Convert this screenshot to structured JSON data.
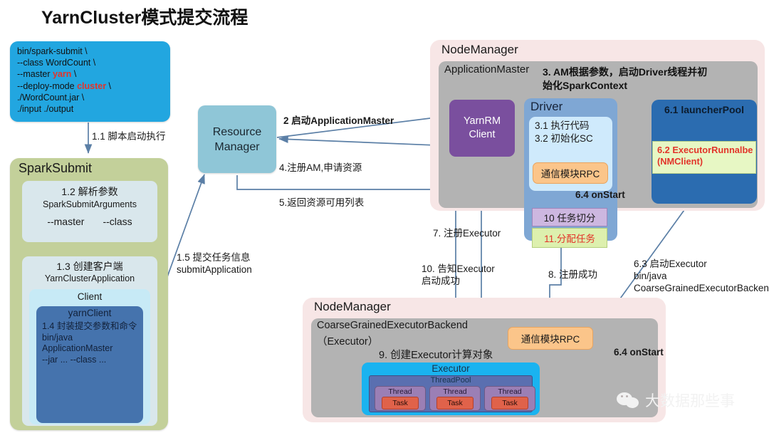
{
  "title": "YarnCluster模式提交流程",
  "command_box": {
    "lines": [
      {
        "text": "bin/spark-submit \\",
        "highlight": ""
      },
      {
        "text": "--class WordCount \\",
        "highlight": ""
      },
      {
        "pre": "--master ",
        "highlight": "yarn",
        "post": " \\"
      },
      {
        "pre": "--deploy-mode ",
        "highlight": "cluster",
        "post": " \\"
      },
      {
        "text": "./WordCount.jar \\",
        "highlight": ""
      },
      {
        "text": "./input ./output",
        "highlight": ""
      }
    ],
    "color": "#22a6e0",
    "highlight_color": "#e2342a"
  },
  "spark_submit": {
    "title": "SparkSubmit",
    "color": "#c3d09a",
    "args_box": {
      "heading": "1.2 解析参数",
      "class_name": "SparkSubmitArguments",
      "opt_master": "--master",
      "opt_class": "--class"
    },
    "client_box": {
      "heading": "1.3 创建客户端",
      "class_name": "YarnClusterApplication",
      "client_label": "Client",
      "yarn_client_label": "yarnClient",
      "detail_lines": [
        "1.4 封装提交参数和命令",
        "bin/java",
        "ApplicationMaster",
        "--jar ... --class ..."
      ]
    }
  },
  "resource_manager": {
    "line1": "Resource",
    "line2": "Manager",
    "color": "#8fc6d7"
  },
  "node_manager_top": {
    "title": "NodeManager",
    "application_master": {
      "title": "ApplicationMaster",
      "note_line1": "3. AM根据参数，启动Driver线程并初",
      "note_line2": "始化SparkContext"
    },
    "yarn_rm_client": {
      "line1": "YarnRM",
      "line2": "Client",
      "color": "#7a4f9e"
    },
    "driver": {
      "title": "Driver",
      "color": "#7fa7d4",
      "step_3_1": "3.1 执行代码",
      "step_3_2": "3.2 初始化SC",
      "rpc_label": "通信模块RPC",
      "split_task": "10 任务切分",
      "assign_task": "11.分配任务"
    },
    "launcher_pool": {
      "title": "6.1 launcherPool",
      "color": "#2b6cb0",
      "executor_runnable_line1": "6.2 ExecutorRunnalbe",
      "executor_runnable_line2": "(NMClient)"
    }
  },
  "node_manager_bottom": {
    "title": "NodeManager",
    "backend_line1": "CoarseGrainedExecutorBackend",
    "backend_line2": "（Executor）",
    "backend_line3": "9. 创建Executor计算对象",
    "rpc_label": "通信模块RPC",
    "executor": {
      "title": "Executor",
      "thread_pool_label": "ThreadPool",
      "threads": [
        {
          "label": "Thread",
          "task": "Task"
        },
        {
          "label": "Thread",
          "task": "Task"
        },
        {
          "label": "Thread",
          "task": "Task"
        }
      ]
    }
  },
  "flow_labels": {
    "step_1_1": "1.1 脚本启动执行",
    "step_2": "2 启动ApplicationMaster",
    "step_4": "4.注册AM,申请资源",
    "step_5": "5.返回资源可用列表",
    "step_1_5_line1": "1.5 提交任务信息",
    "step_1_5_line2": "submitApplication",
    "step_7": "7. 注册Executor",
    "step_10_line1": "10. 告知Executor",
    "step_10_line2": "启动成功",
    "step_8": "8. 注册成功",
    "step_6_3_line1": "6.3 启动Executor",
    "step_6_3_line2": "bin/java",
    "step_6_3_line3": "CoarseGrainedExecutorBackend",
    "step_6_4_top": "6.4 onStart",
    "step_6_4_bottom": "6.4 onStart"
  },
  "watermark": {
    "text": "大数据那些事",
    "icon": "wechat-icon"
  },
  "colors": {
    "arrow": "#5b7fa6",
    "pink_container": "#f7e6e6",
    "gray_container": "#b3b3b3",
    "orange_rpc": "#fbc58a",
    "red_text": "#e2342a"
  }
}
